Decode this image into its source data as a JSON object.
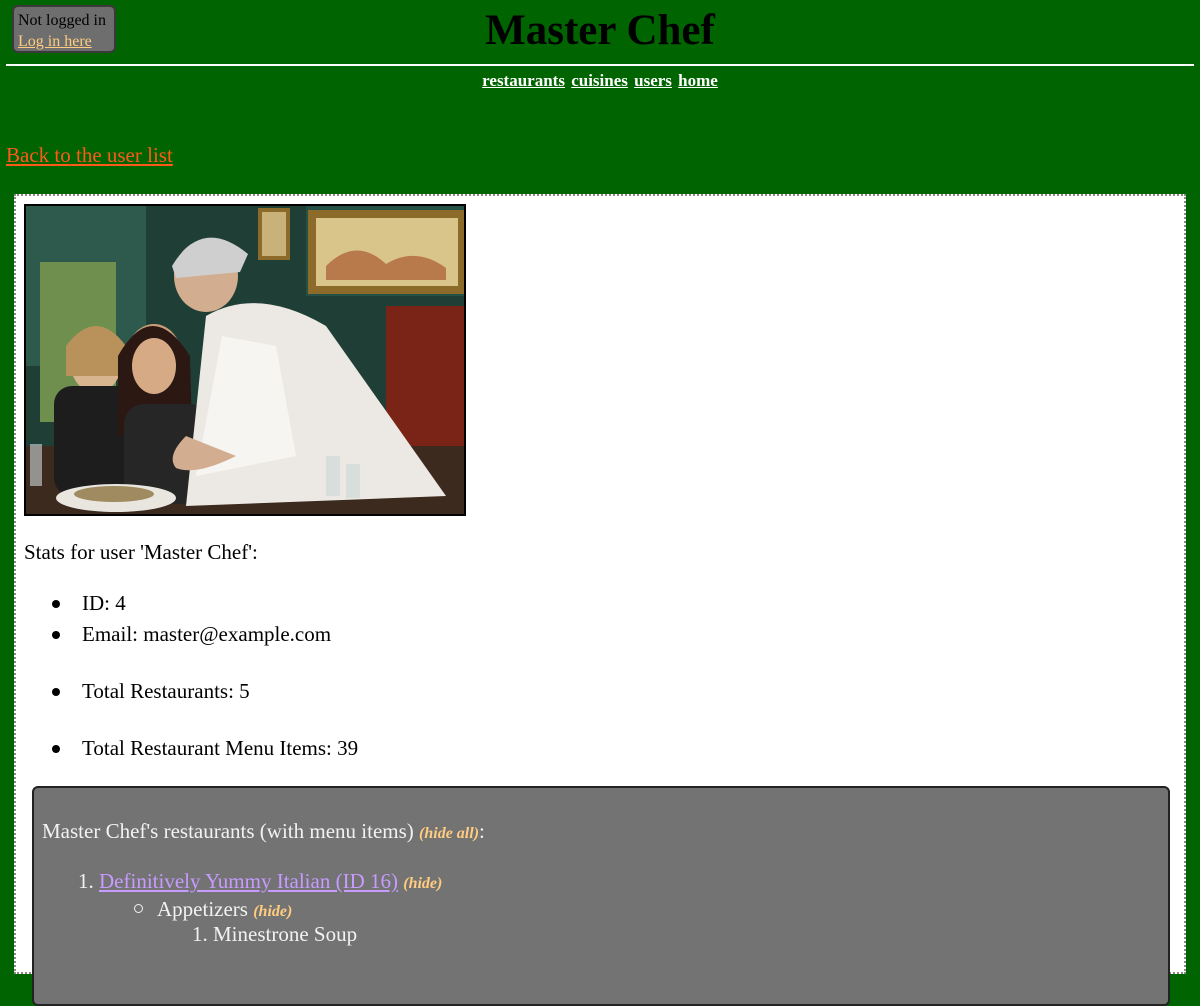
{
  "login": {
    "status": "Not logged in",
    "link_label": "Log in here"
  },
  "header": {
    "title": "Master Chef"
  },
  "nav": {
    "items": [
      "restaurants",
      "cuisines",
      "users",
      "home"
    ]
  },
  "back_link": "Back to the user list",
  "user": {
    "photo_icon": "chef-photo",
    "stats_title": "Stats for user 'Master Chef':",
    "stats": [
      "ID: 4",
      "Email: master@example.com",
      "Total Restaurants: 5",
      "Total Restaurant Menu Items: 39"
    ]
  },
  "restaurants": {
    "heading": "Master Chef's restaurants (with menu items)",
    "hide_all_label": "(hide all)",
    "heading_suffix": ":",
    "items": [
      {
        "number": "1.",
        "name": "Definitively Yummy Italian (ID 16)",
        "hide_label": "(hide)",
        "categories": [
          {
            "name": "Appetizers",
            "hide_label": "(hide)",
            "menu_items": [
              {
                "number": "1.",
                "name": "Minestrone Soup"
              }
            ]
          }
        ]
      }
    ]
  },
  "colors": {
    "page_bg": "#006400",
    "back_link": "#ff5a1a",
    "restaurant_link": "#c79bff",
    "hide_link": "#ffcc80",
    "restaurants_panel": "#737373"
  }
}
